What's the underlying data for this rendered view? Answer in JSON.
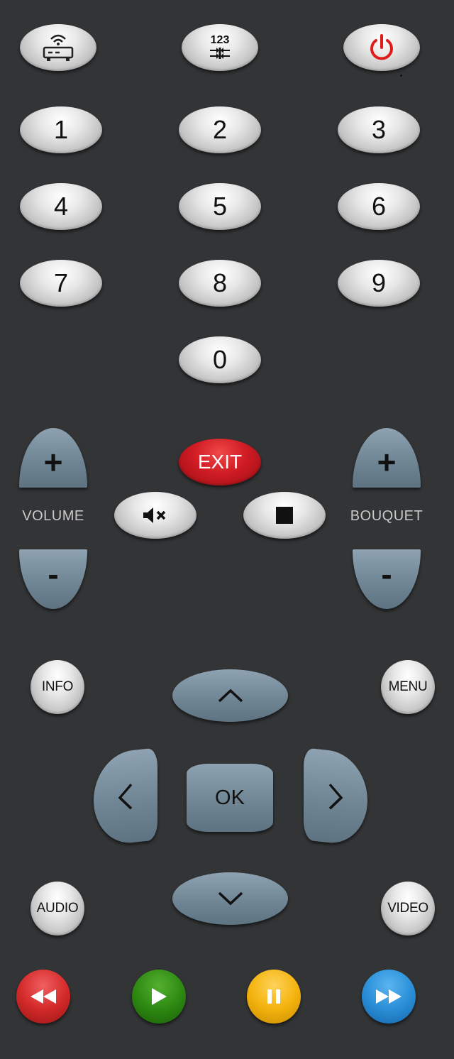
{
  "top_row": {
    "receiver_icon": "wifi-router-icon",
    "numpad_toggle_label": "123",
    "power_icon": "power-icon",
    "power_color": "#e11b1b"
  },
  "numpad": {
    "keys": [
      "1",
      "2",
      "3",
      "4",
      "5",
      "6",
      "7",
      "8",
      "9",
      "0"
    ]
  },
  "controls": {
    "exit_label": "EXIT",
    "volume_label": "VOLUME",
    "bouquet_label": "BOUQUET",
    "plus_label": "+",
    "minus_label": "-",
    "mute_icon": "mute-icon",
    "stop_icon": "stop-icon"
  },
  "navigation": {
    "info_label": "INFO",
    "menu_label": "MENU",
    "ok_label": "OK",
    "audio_label": "AUDIO",
    "video_label": "VIDEO"
  },
  "media": {
    "rewind_color": "#d42a2a",
    "play_color": "#2e8a12",
    "pause_color": "#f4b40f",
    "fast_forward_color": "#2b90d8"
  }
}
